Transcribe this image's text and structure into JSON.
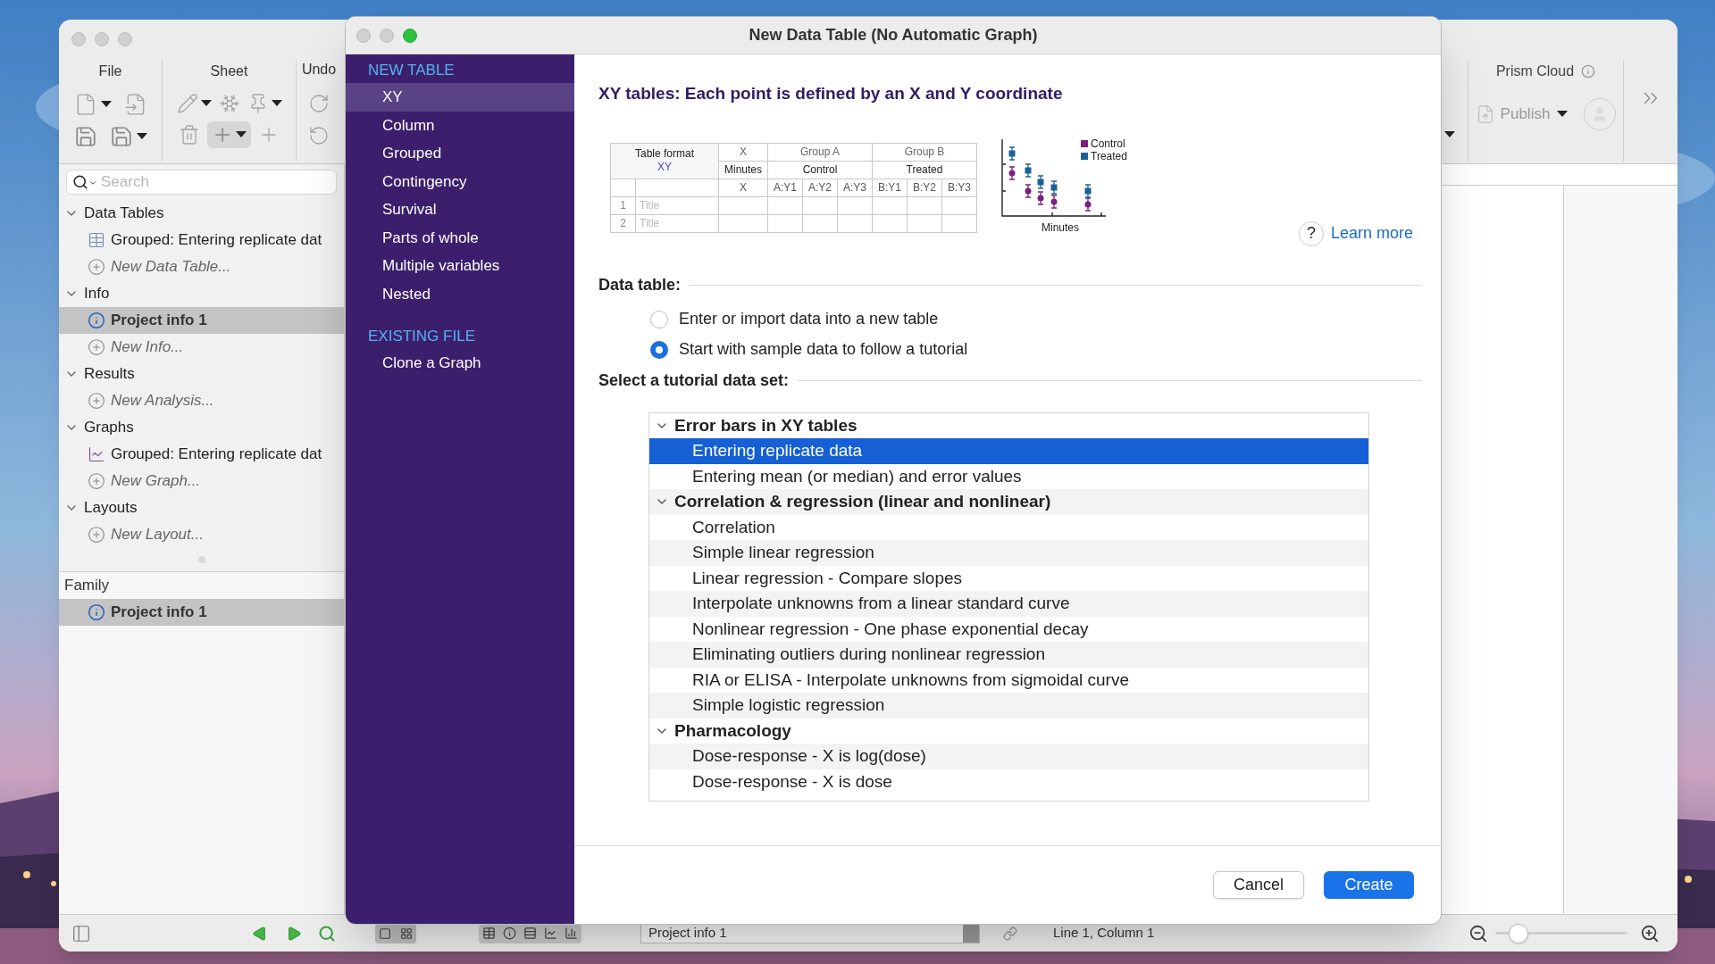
{
  "main_window": {
    "toolbar": {
      "groups": [
        {
          "label": "File"
        },
        {
          "label": "Sheet"
        },
        {
          "label": "Undo"
        }
      ],
      "cloud_label": "Prism Cloud",
      "publish": "Publish"
    },
    "search": {
      "placeholder": "Search"
    },
    "navigator": [
      {
        "label": "Data Tables",
        "expanded": true,
        "children": [
          {
            "label": "Grouped: Entering replicate dat",
            "kind": "table",
            "selected": false
          },
          {
            "label": "New Data Table...",
            "kind": "new",
            "selected": false
          }
        ]
      },
      {
        "label": "Info",
        "expanded": true,
        "children": [
          {
            "label": "Project info 1",
            "kind": "info",
            "selected": true
          },
          {
            "label": "New Info...",
            "kind": "new",
            "selected": false
          }
        ]
      },
      {
        "label": "Results",
        "expanded": true,
        "children": [
          {
            "label": "New Analysis...",
            "kind": "new",
            "selected": false
          }
        ]
      },
      {
        "label": "Graphs",
        "expanded": true,
        "children": [
          {
            "label": "Grouped: Entering replicate dat",
            "kind": "graph",
            "selected": false
          },
          {
            "label": "New Graph...",
            "kind": "new",
            "selected": false
          }
        ]
      },
      {
        "label": "Layouts",
        "expanded": true,
        "children": [
          {
            "label": "New Layout...",
            "kind": "new",
            "selected": false
          }
        ]
      }
    ],
    "family": {
      "label": "Family",
      "items": [
        {
          "label": "Project info 1",
          "kind": "info",
          "selected": true
        }
      ]
    },
    "status_bar": {
      "sheet_field": "Project info 1",
      "position": "Line 1, Column 1",
      "zoom": {
        "level": 0.12
      }
    }
  },
  "dialog": {
    "title": "New Data Table (No Automatic Graph)",
    "sidebar": [
      {
        "heading": "NEW TABLE",
        "items": [
          {
            "label": "XY",
            "selected": true
          },
          {
            "label": "Column",
            "selected": false
          },
          {
            "label": "Grouped",
            "selected": false
          },
          {
            "label": "Contingency",
            "selected": false
          },
          {
            "label": "Survival",
            "selected": false
          },
          {
            "label": "Parts of whole",
            "selected": false
          },
          {
            "label": "Multiple variables",
            "selected": false
          },
          {
            "label": "Nested",
            "selected": false
          }
        ]
      },
      {
        "heading": "EXISTING FILE",
        "items": [
          {
            "label": "Clone a Graph",
            "selected": false
          }
        ]
      }
    ],
    "heading": "XY tables: Each point is defined by an X and Y coordinate",
    "preview": {
      "table": {
        "corner": "Table format",
        "format": "XY",
        "x_heading": "X",
        "x_title": "Minutes",
        "x_column": "X",
        "groups": [
          {
            "name": "Group A",
            "title": "Control",
            "columns": [
              "A:Y1",
              "A:Y2",
              "A:Y3"
            ]
          },
          {
            "name": "Group B",
            "title": "Treated",
            "columns": [
              "B:Y1",
              "B:Y2",
              "B:Y3"
            ]
          }
        ],
        "rows": [
          {
            "number": "1",
            "title": "Title"
          },
          {
            "number": "2",
            "title": "Title"
          }
        ]
      },
      "legend": [
        {
          "label": "Control",
          "color": "#7a1f7f"
        },
        {
          "label": "Treated",
          "color": "#1c6196"
        }
      ],
      "xlabel": "Minutes"
    },
    "help": "?",
    "learn_more": "Learn more",
    "data_table": {
      "label": "Data table:",
      "options": [
        {
          "label": "Enter or import data into a new table",
          "selected": false
        },
        {
          "label": "Start with sample data to follow a tutorial",
          "selected": true
        }
      ]
    },
    "tutorial": {
      "label": "Select a tutorial data set:",
      "groups": [
        {
          "label": "Error bars in XY tables",
          "expanded": true,
          "children": [
            {
              "label": "Entering replicate data",
              "selected": true
            },
            {
              "label": "Entering mean (or median) and error values",
              "selected": false
            }
          ]
        },
        {
          "label": "Correlation & regression (linear and nonlinear)",
          "expanded": true,
          "children": [
            {
              "label": "Correlation",
              "selected": false
            },
            {
              "label": "Simple linear regression",
              "selected": false
            },
            {
              "label": "Linear regression - Compare slopes",
              "selected": false
            },
            {
              "label": "Interpolate unknowns from a linear standard curve",
              "selected": false
            },
            {
              "label": "Nonlinear regression - One phase exponential decay",
              "selected": false
            },
            {
              "label": "Eliminating outliers during nonlinear regression",
              "selected": false
            },
            {
              "label": "RIA or ELISA - Interpolate unknowns from sigmoidal curve",
              "selected": false
            },
            {
              "label": "Simple logistic regression",
              "selected": false
            }
          ]
        },
        {
          "label": "Pharmacology",
          "expanded": true,
          "children": [
            {
              "label": "Dose-response - X is log(dose)",
              "selected": false
            },
            {
              "label": "Dose-response - X is dose",
              "selected": false
            }
          ]
        }
      ]
    },
    "buttons": [
      {
        "label": "Cancel",
        "kind": "secondary"
      },
      {
        "label": "Create",
        "kind": "primary"
      }
    ]
  }
}
